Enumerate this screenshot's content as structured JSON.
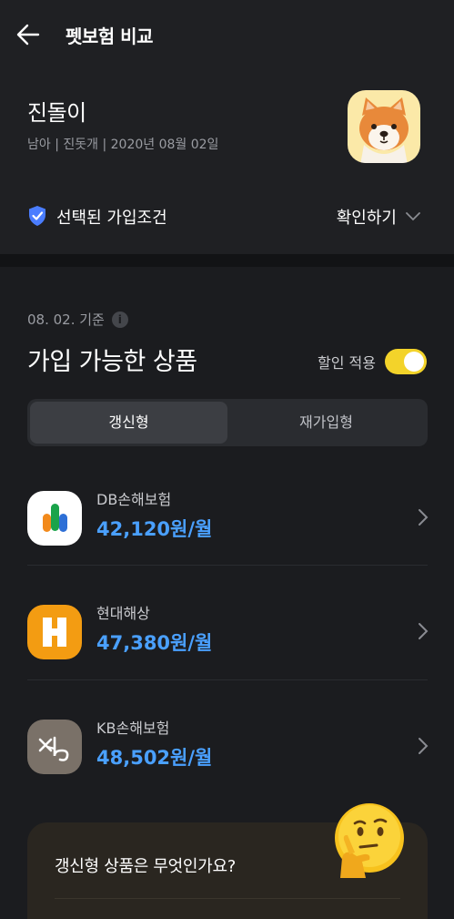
{
  "header": {
    "title": "펫보험 비교"
  },
  "pet": {
    "name": "진돌이",
    "info": "남아 | 진돗개 | 2020년 08월 02일"
  },
  "condition": {
    "label": "선택된 가입조건",
    "confirm": "확인하기"
  },
  "section": {
    "date": "08. 02. 기준",
    "title": "가입 가능한 상품",
    "discount_label": "할인 적용",
    "discount_on": true
  },
  "tabs": [
    {
      "label": "갱신형",
      "active": true
    },
    {
      "label": "재가입형",
      "active": false
    }
  ],
  "products": [
    {
      "company": "DB손해보험",
      "price": "42,120원/월",
      "logo_icon": "db-logo-icon"
    },
    {
      "company": "현대해상",
      "price": "47,380원/월",
      "logo_icon": "hyundai-logo-icon"
    },
    {
      "company": "KB손해보험",
      "price": "48,502원/월",
      "logo_icon": "kb-logo-icon"
    }
  ],
  "faq": {
    "question": "갱신형 상품은 무엇인가요?"
  },
  "colors": {
    "accent_price": "#4aa0ff",
    "toggle": "#f3d32a",
    "shield": "#4a7dff"
  }
}
